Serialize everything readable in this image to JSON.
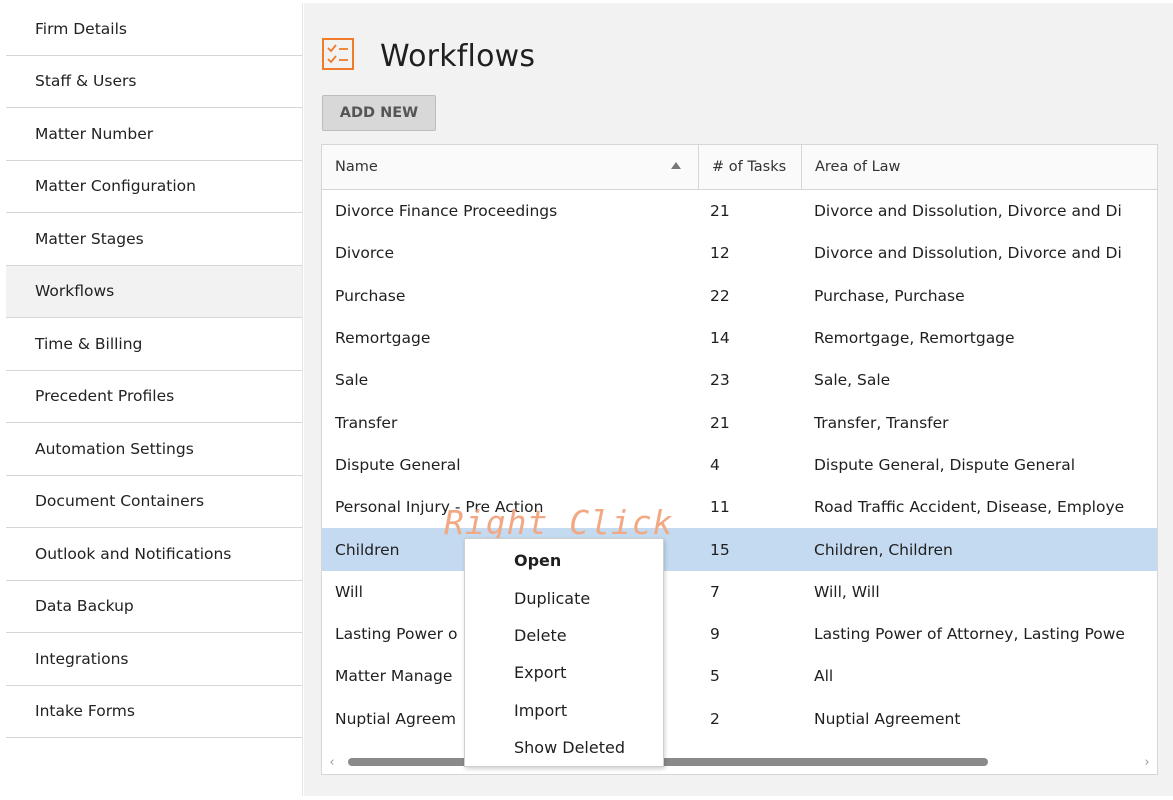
{
  "sidebar": {
    "items": [
      {
        "label": "Firm Details"
      },
      {
        "label": "Staff & Users"
      },
      {
        "label": "Matter Number"
      },
      {
        "label": "Matter Configuration"
      },
      {
        "label": "Matter Stages"
      },
      {
        "label": "Workflows",
        "active": true
      },
      {
        "label": "Time & Billing"
      },
      {
        "label": "Precedent Profiles"
      },
      {
        "label": "Automation Settings"
      },
      {
        "label": "Document Containers"
      },
      {
        "label": "Outlook and Notifications"
      },
      {
        "label": "Data Backup"
      },
      {
        "label": "Integrations"
      },
      {
        "label": "Intake Forms"
      }
    ]
  },
  "header": {
    "title": "Workflows",
    "icon": "checklist-icon",
    "accent": "#f07b2a"
  },
  "toolbar": {
    "add_new_label": "ADD NEW"
  },
  "grid": {
    "columns": [
      "Name",
      "# of Tasks",
      "Area of Law"
    ],
    "sort": {
      "column": "Name",
      "direction": "ascending"
    },
    "rows": [
      {
        "name": "Divorce Finance Proceedings",
        "tasks": "21",
        "area": "Divorce and Dissolution, Divorce and Di"
      },
      {
        "name": "Divorce",
        "tasks": "12",
        "area": "Divorce and Dissolution, Divorce and Di"
      },
      {
        "name": "Purchase",
        "tasks": "22",
        "area": "Purchase, Purchase"
      },
      {
        "name": "Remortgage",
        "tasks": "14",
        "area": "Remortgage, Remortgage"
      },
      {
        "name": "Sale",
        "tasks": "23",
        "area": "Sale, Sale"
      },
      {
        "name": "Transfer",
        "tasks": "21",
        "area": "Transfer, Transfer"
      },
      {
        "name": "Dispute General",
        "tasks": "4",
        "area": "Dispute General, Dispute General"
      },
      {
        "name": "Personal Injury - Pre Action",
        "tasks": "11",
        "area": "Road Traffic Accident, Disease, Employe"
      },
      {
        "name": "Children",
        "tasks": "15",
        "area": "Children, Children",
        "selected": true
      },
      {
        "name": "Will",
        "tasks": "7",
        "area": "Will, Will"
      },
      {
        "name": "Lasting Power o",
        "tasks": "9",
        "area": "Lasting Power of Attorney, Lasting Powe"
      },
      {
        "name": "Matter Manage",
        "tasks": "5",
        "area": "All"
      },
      {
        "name": "Nuptial Agreem",
        "tasks": "2",
        "area": "Nuptial Agreement"
      }
    ],
    "selected_color": "#c4daf0",
    "scroll_left": "‹",
    "scroll_right": "›"
  },
  "context_menu": {
    "items": [
      {
        "label": "Open",
        "default": true
      },
      {
        "label": "Duplicate"
      },
      {
        "label": "Delete"
      },
      {
        "label": "Export"
      },
      {
        "label": "Import"
      },
      {
        "label": "Show Deleted"
      }
    ]
  },
  "annotation": {
    "text": "Right Click",
    "color": "#f2a883"
  }
}
